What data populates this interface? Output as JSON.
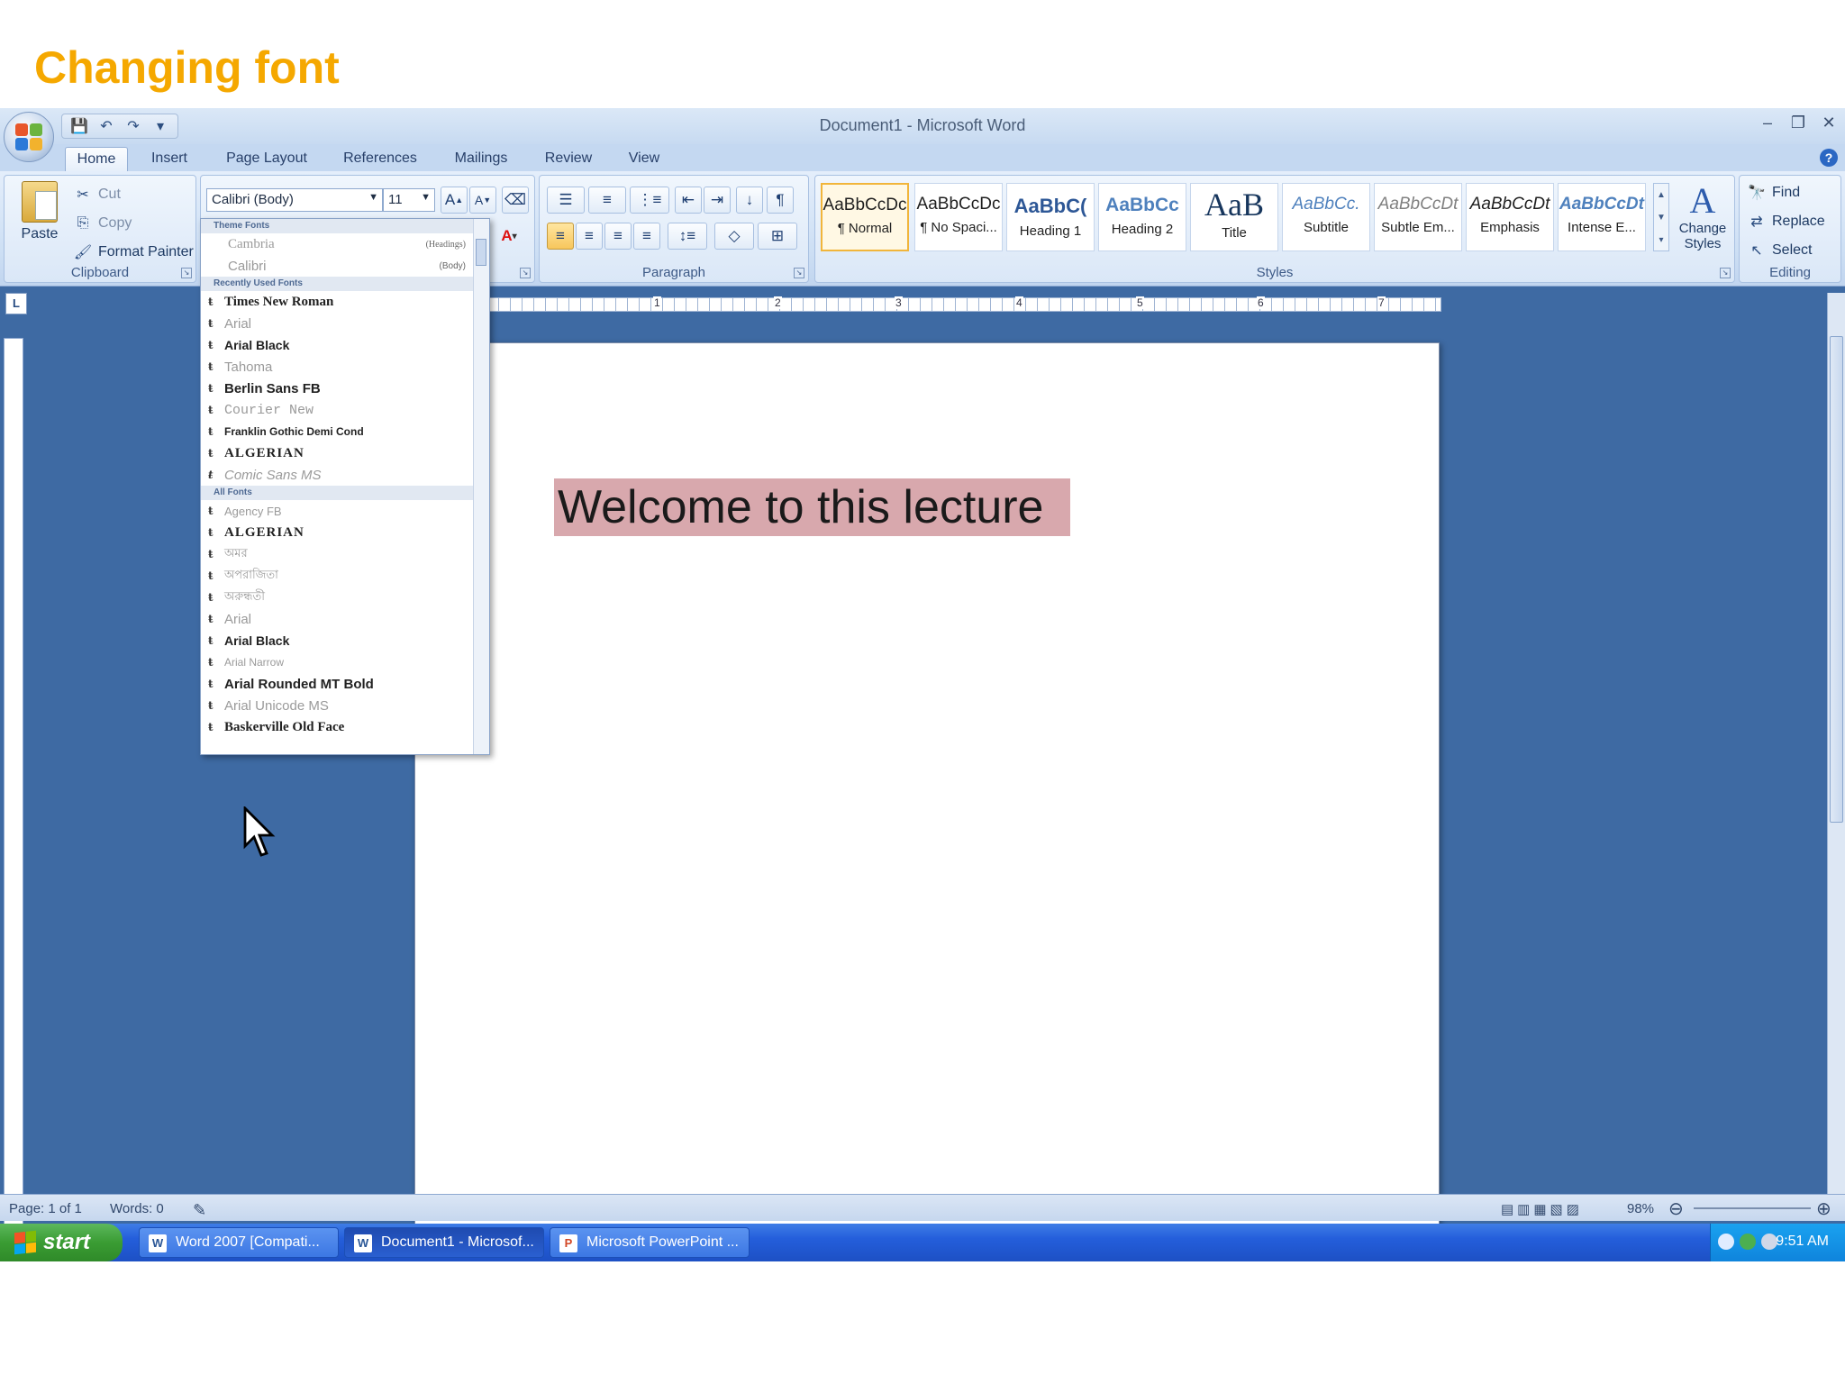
{
  "slide": {
    "title": "Changing font"
  },
  "window": {
    "title": "Document1 - Microsoft Word"
  },
  "tabs": [
    "Home",
    "Insert",
    "Page Layout",
    "References",
    "Mailings",
    "Review",
    "View"
  ],
  "clipboard": {
    "paste": "Paste",
    "cut": "Cut",
    "copy": "Copy",
    "format_painter": "Format Painter",
    "label": "Clipboard"
  },
  "font": {
    "name": "Calibri (Body)",
    "size": "11"
  },
  "paragraph": {
    "label": "Paragraph"
  },
  "styles": {
    "label": "Styles",
    "items": [
      {
        "sample": "AaBbCcDc",
        "name": "¶ Normal"
      },
      {
        "sample": "AaBbCcDc",
        "name": "¶ No Spaci..."
      },
      {
        "sample": "AaBbC(",
        "name": "Heading 1"
      },
      {
        "sample": "AaBbCc",
        "name": "Heading 2"
      },
      {
        "sample": "AaB",
        "name": "Title"
      },
      {
        "sample": "AaBbCc.",
        "name": "Subtitle"
      },
      {
        "sample": "AaBbCcDt",
        "name": "Subtle Em..."
      },
      {
        "sample": "AaBbCcDt",
        "name": "Emphasis"
      },
      {
        "sample": "AaBbCcDt",
        "name": "Intense E..."
      }
    ],
    "change_styles": "Change Styles"
  },
  "editing": {
    "find": "Find",
    "replace": "Replace",
    "select": "Select",
    "label": "Editing"
  },
  "font_dropdown": {
    "theme_heading": "Theme Fonts",
    "theme_fonts": [
      {
        "name": "Cambria",
        "tag": "(Headings)"
      },
      {
        "name": "Calibri",
        "tag": "(Body)"
      }
    ],
    "recent_heading": "Recently Used Fonts",
    "recent_fonts": [
      "Times New Roman",
      "Arial",
      "Arial Black",
      "Tahoma",
      "Berlin Sans FB",
      "Courier New",
      "Franklin Gothic Demi Cond",
      "ALGERIAN",
      "Comic Sans MS"
    ],
    "all_heading": "All Fonts",
    "all_fonts": [
      "Agency FB",
      "ALGERIAN",
      "অমর",
      "অপরাজিতা",
      "অরুন্ধতী",
      "Arial",
      "Arial Black",
      "Arial Narrow",
      "Arial Rounded MT Bold",
      "Arial Unicode MS",
      "Baskerville Old Face"
    ]
  },
  "document": {
    "text": "Welcome to this lecture"
  },
  "ruler_numbers": [
    "1",
    "2",
    "3",
    "4",
    "5",
    "6",
    "7"
  ],
  "status": {
    "page": "Page: 1 of 1",
    "words": "Words: 0",
    "zoom": "98%"
  },
  "taskbar": {
    "start": "start",
    "buttons": [
      "Word 2007 [Compati...",
      "Document1 - Microsof...",
      "Microsoft PowerPoint ..."
    ],
    "clock": "9:51 AM"
  }
}
